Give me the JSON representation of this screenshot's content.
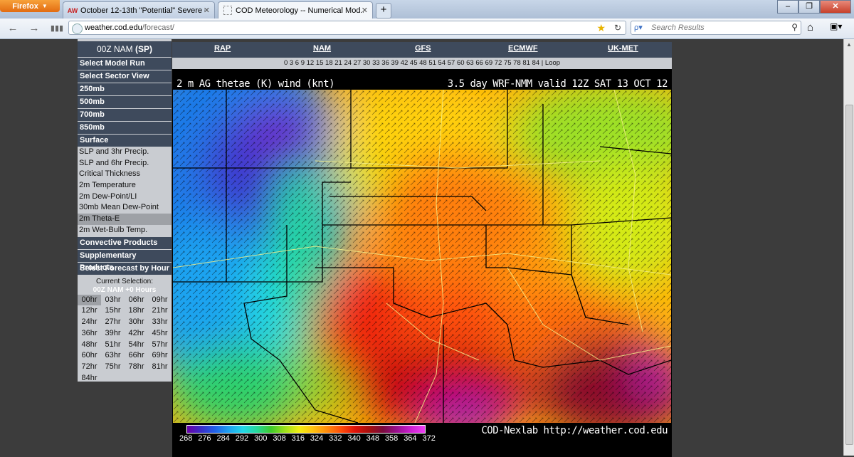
{
  "browser": {
    "app_button": "Firefox",
    "tabs": [
      {
        "label": "October 12-13th \"Potential\" Severe O...",
        "icon": "AW"
      },
      {
        "label": "COD Meteorology -- Numerical Mod...",
        "icon": "page"
      }
    ],
    "url_domain": "weather.cod.edu",
    "url_path": "/forecast/",
    "search_placeholder": "Search Results"
  },
  "menu": {
    "model_label": "00Z NAM",
    "model_region": "(SP)",
    "sections": {
      "model_run": "Select Model Run",
      "sector_view": "Select Sector View",
      "mb250": "250mb",
      "mb500": "500mb",
      "mb700": "700mb",
      "mb850": "850mb",
      "surface": "Surface",
      "convective": "Convective Products",
      "supplementary": "Supplementary Products",
      "forecast_hour": "Select Forecast by Hour"
    },
    "surface_items": [
      "SLP and 3hr Precip.",
      "SLP and 6hr Precip.",
      "Critical Thickness",
      "2m Temperature",
      "2m Dew-Point/LI",
      "30mb Mean Dew-Point",
      "2m Theta-E",
      "2m Wet-Bulb Temp."
    ],
    "current_label": "Current Selection:",
    "current_value": "00Z NAM +0 Hours",
    "hours": [
      "00hr",
      "03hr",
      "06hr",
      "09hr",
      "12hr",
      "15hr",
      "18hr",
      "21hr",
      "24hr",
      "27hr",
      "30hr",
      "33hr",
      "36hr",
      "39hr",
      "42hr",
      "45hr",
      "48hr",
      "51hr",
      "54hr",
      "57hr",
      "60hr",
      "63hr",
      "66hr",
      "69hr",
      "72hr",
      "75hr",
      "78hr",
      "81hr",
      "84hr"
    ]
  },
  "models": [
    "RAP",
    "NAM",
    "GFS",
    "ECMWF",
    "UK-MET"
  ],
  "hour_links": "0 3 6 9 12 15 18 21 24 27 30 33 36 39 42 45 48 51 54 57 60 63 66 69 72 75 78 81 84 | Loop",
  "map": {
    "title": "2 m AG thetae (K) wind (knt)",
    "valid": "3.5 day WRF-NMM valid 12Z SAT 13 OCT 12",
    "legend_ticks": [
      "268",
      "276",
      "284",
      "292",
      "300",
      "308",
      "316",
      "324",
      "332",
      "340",
      "348",
      "358",
      "364",
      "372"
    ],
    "credit": "COD-Nexlab http://weather.cod.edu"
  }
}
